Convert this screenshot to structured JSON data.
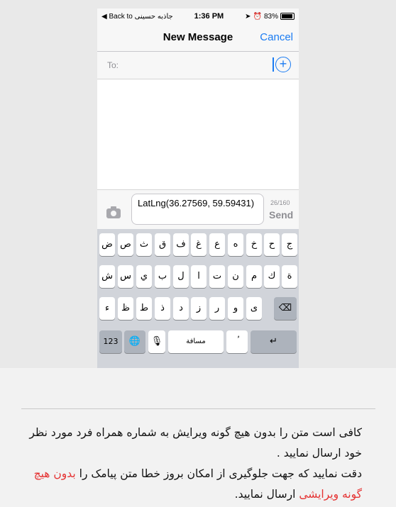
{
  "status_bar": {
    "back_label": "◀ Back to جاذبه حسینی",
    "time": "1:36 PM",
    "battery": "83%"
  },
  "nav": {
    "title": "New Message",
    "cancel": "Cancel"
  },
  "to_field": {
    "label": "To:"
  },
  "compose": {
    "message": "LatLng(36.27569, 59.59431)",
    "char_count": "26/160",
    "send": "Send"
  },
  "keyboard": {
    "row1": [
      "ج",
      "ح",
      "خ",
      "ه",
      "ع",
      "غ",
      "ف",
      "ق",
      "ث",
      "ص",
      "ض"
    ],
    "row2": [
      "ة",
      "ك",
      "م",
      "ن",
      "ت",
      "ا",
      "ل",
      "ب",
      "ي",
      "س",
      "ش"
    ],
    "row3": [
      "ى",
      "و",
      "ر",
      "ز",
      "د",
      "ذ",
      "ط",
      "ظ",
      "ء"
    ],
    "delete": "⌫",
    "numbers": "123",
    "space": "مسافة",
    "extra": "ؘُ",
    "return": "↵"
  },
  "caption": {
    "line1": "کافی است متن را بدون هیچ گونه ویرایش به شماره همراه فرد مورد نظر خود ارسال نمایید .",
    "line2a": "دقت نمایید که جهت جلوگیری از امکان بروز خطا متن پیامک را ",
    "line2_red": "بدون هیچ گونه ویرایشی",
    "line2b": " ارسال نمایید."
  }
}
